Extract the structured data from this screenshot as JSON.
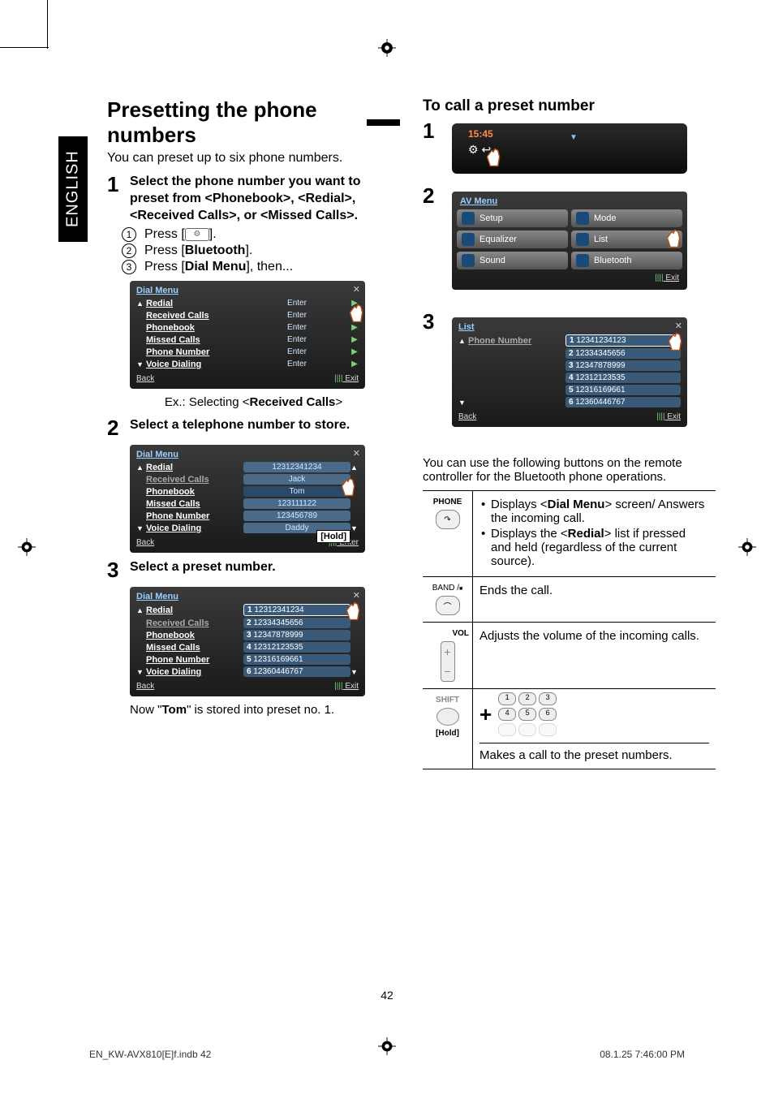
{
  "page_number": "42",
  "language_tab": "ENGLISH",
  "footer_file": "EN_KW-AVX810[E]f.indb   42",
  "footer_time": "08.1.25   7:46:00 PM",
  "left": {
    "heading": "Presetting the phone numbers",
    "intro": "You can preset up to six phone numbers.",
    "step1_title": "Select the phone number you want to preset from <Phonebook>, <Redial>, <Received Calls>, or <Missed Calls>.",
    "sub1": "Press [",
    "sub1_end": "].",
    "sub2_pre": "Press [",
    "sub2_bold": "Bluetooth",
    "sub2_post": "].",
    "sub3_pre": "Press [",
    "sub3_bold": "Dial Menu",
    "sub3_post": "], then...",
    "dial_menu_title": "Dial Menu",
    "dial_items": [
      "Redial",
      "Received Calls",
      "Phonebook",
      "Missed Calls",
      "Phone Number",
      "Voice Dialing"
    ],
    "enter_label": "Enter",
    "back_label": "Back",
    "exit_label": "Exit",
    "caption1_pre": "Ex.: Selecting <",
    "caption1_bold": "Received Calls",
    "caption1_post": ">",
    "step2_title": "Select a telephone number to store.",
    "contact_list": [
      "12312341234",
      "Jack",
      "Tom",
      "123111122",
      "123456789",
      "Daddy"
    ],
    "hold_label": "[Hold]",
    "enter_small": "Enter",
    "step3_title": "Select a preset number.",
    "preset_list": [
      "12312341234",
      "12334345656",
      "12347878999",
      "12312123535",
      "12316169661",
      "12360446767"
    ],
    "note_pre": "Now \"",
    "note_bold": "Tom",
    "note_post": "\" is stored into preset no. 1."
  },
  "right": {
    "heading": "To call a preset number",
    "clock": "15:45",
    "av_menu_title": "AV Menu",
    "av_buttons": [
      "Setup",
      "Mode",
      "Equalizer",
      "List",
      "Sound",
      "Bluetooth"
    ],
    "list_title": "List",
    "phone_number_label": "Phone Number",
    "preset_list": [
      "12341234123",
      "12334345656",
      "12347878999",
      "12312123535",
      "12316169661",
      "12360446767"
    ],
    "remote_intro": "You can use the following buttons on the remote controller for the Bluetooth phone operations.",
    "phone_label": "PHONE",
    "phone_b1_pre": "Displays <",
    "phone_b1_bold": "Dial Menu",
    "phone_b1_post": "> screen/ Answers the incoming call.",
    "phone_b2_pre": "Displays the <",
    "phone_b2_bold": "Redial",
    "phone_b2_post": "> list if pressed and held (regardless of the current source).",
    "band_label": "BAND /",
    "band_desc": "Ends the call.",
    "vol_label": "VOL",
    "vol_desc": "Adjusts the volume of the incoming calls.",
    "shift_label": "SHIFT",
    "hold_label": "[Hold]",
    "shift_desc": "Makes a call to the preset numbers."
  }
}
